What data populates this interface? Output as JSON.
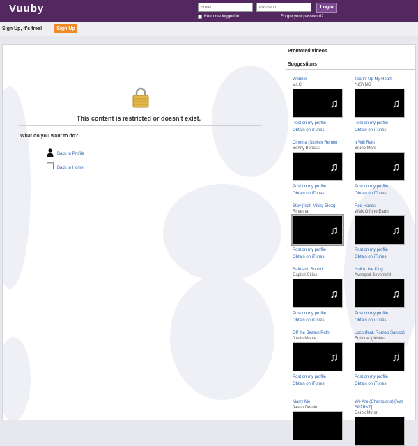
{
  "header": {
    "logo": "Vuuby",
    "email_placeholder": "Email",
    "password_placeholder": "Password",
    "login_label": "Login",
    "keep_logged_label": "Keep me logged in",
    "forgot_label": "Forgot your password?"
  },
  "signup": {
    "text": "Sign Up, it's free!",
    "button": "Sign Up"
  },
  "main": {
    "message": "This content is restricted or doesn't exist.",
    "what_heading": "What do you want to do?",
    "back_profile": "Back to Profile",
    "back_home": "Back to Home"
  },
  "sidebar": {
    "promoted_heading": "Promoted videos",
    "suggestions_heading": "Suggestions",
    "post_label": "Post on my profile",
    "obtain_label": "Obtain on iTunes",
    "items": [
      {
        "title": "Wobble",
        "artist": "V.I.C."
      },
      {
        "title": "Tearin' Up My Heart",
        "artist": "*NSYNC"
      },
      {
        "title": "Cinema (Skrillex Remix)",
        "artist": "Benny Benassi"
      },
      {
        "title": "It Will Rain",
        "artist": "Bruno Mars"
      },
      {
        "title": "Stay (feat. Mikky Ekko)",
        "artist": "Rihanna"
      },
      {
        "title": "Red Hands",
        "artist": "Walk Off the Earth"
      },
      {
        "title": "Safe and Sound",
        "artist": "Capital Cities"
      },
      {
        "title": "Hail to the King",
        "artist": "Avenged Sevenfold"
      },
      {
        "title": "Off the Beaten Path",
        "artist": "Justin Moore"
      },
      {
        "title": "Loco (feat. Romeo Santos)",
        "artist": "Enrique Iglesias"
      },
      {
        "title": "Marry Me",
        "artist": "Jason Derulo"
      },
      {
        "title": "We Are (Champions) [feat. SPZRKT]",
        "artist": "Derek Minor"
      }
    ]
  },
  "icons": {
    "note": "♫"
  },
  "colors": {
    "header_bg": "#532860",
    "signup_button": "#f08a24",
    "link": "#2a63ad"
  }
}
